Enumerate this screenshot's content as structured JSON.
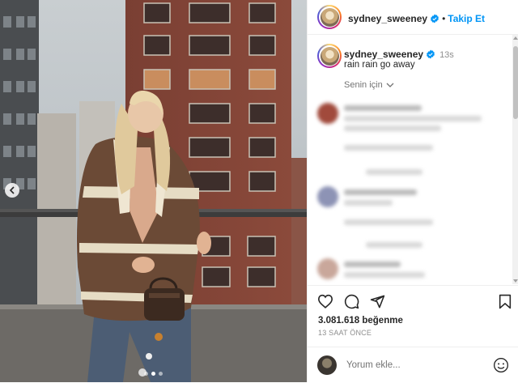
{
  "post": {
    "username": "sydney_sweeney",
    "follow_label": "Takip Et",
    "separator": "•",
    "more_icon": "more-horizontal-icon",
    "caption": "rain rain go away",
    "caption_time": "13s",
    "sort_label": "Senin için",
    "likes": "3.081.618 beğenme",
    "time_ago": "13 SAAT ÖNCE",
    "comment_placeholder": "Yorum ekle...",
    "carousel": {
      "dot_count": 3,
      "active_dot": 1
    }
  },
  "colors": {
    "accent": "#0095f6",
    "text": "#262626",
    "muted": "#8e8e8e",
    "border": "#efefef"
  },
  "icons": [
    "verified-badge-icon",
    "heart-icon",
    "comment-icon",
    "share-icon",
    "bookmark-icon",
    "emoji-icon",
    "chevron-down-icon",
    "chevron-left-icon"
  ]
}
